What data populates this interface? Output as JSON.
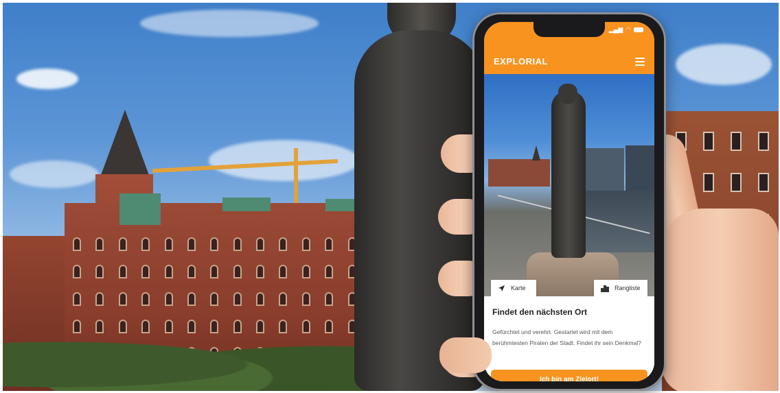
{
  "app": {
    "brand": "EXPLORIAL",
    "accent_color": "#f7931e",
    "menu_icon": "hamburger-icon"
  },
  "photo_controls": {
    "map_label": "Karte",
    "map_icon": "navigation-arrow-icon",
    "ranking_label": "Rangliste",
    "ranking_icon": "podium-icon"
  },
  "card": {
    "title": "Findet den nächsten Ort",
    "description": "Gefürchtet und verehrt. Gestartet wird mit dem berühmtesten Piraten der Stadt. Findet ihr sein Denkmal?",
    "button_label": "Ich bin am Zielort!"
  }
}
